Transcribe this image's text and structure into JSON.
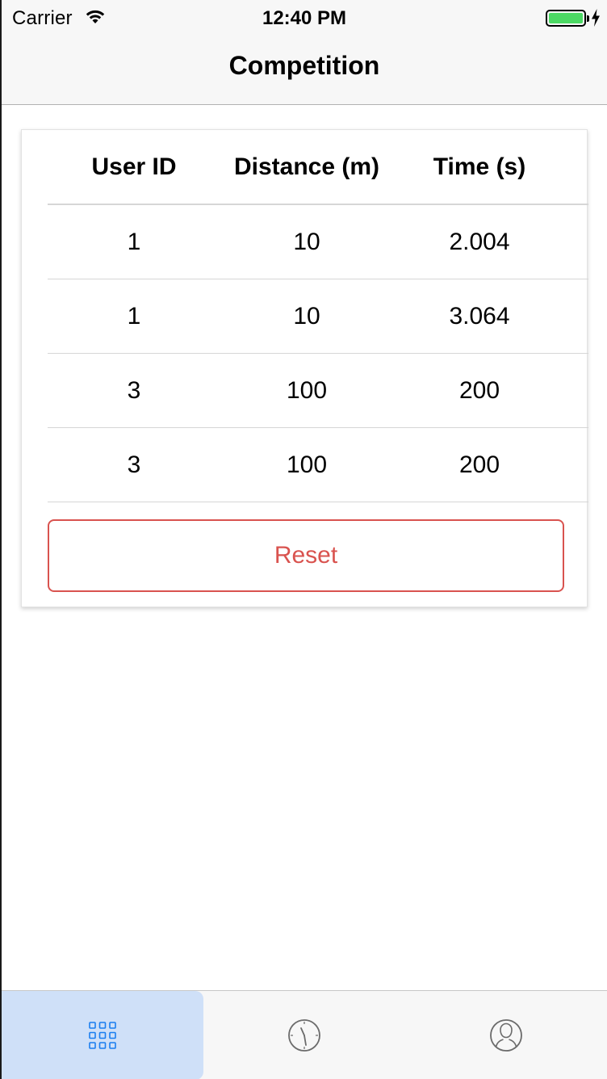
{
  "status_bar": {
    "carrier": "Carrier",
    "time": "12:40 PM",
    "battery_color": "#4cd964"
  },
  "nav": {
    "title": "Competition"
  },
  "table": {
    "columns": [
      "User ID",
      "Distance (m)",
      "Time (s)"
    ],
    "rows": [
      [
        "1",
        "10",
        "2.004"
      ],
      [
        "1",
        "10",
        "3.064"
      ],
      [
        "3",
        "100",
        "200"
      ],
      [
        "3",
        "100",
        "200"
      ]
    ]
  },
  "reset_button": {
    "label": "Reset",
    "color": "#d9534f"
  },
  "tab_bar": {
    "tabs": [
      {
        "icon": "grid-icon",
        "selected": true,
        "color": "#1a7ef0"
      },
      {
        "icon": "clock-icon",
        "selected": false,
        "color": "#6b6b6b"
      },
      {
        "icon": "profile-icon",
        "selected": false,
        "color": "#6b6b6b"
      }
    ]
  }
}
